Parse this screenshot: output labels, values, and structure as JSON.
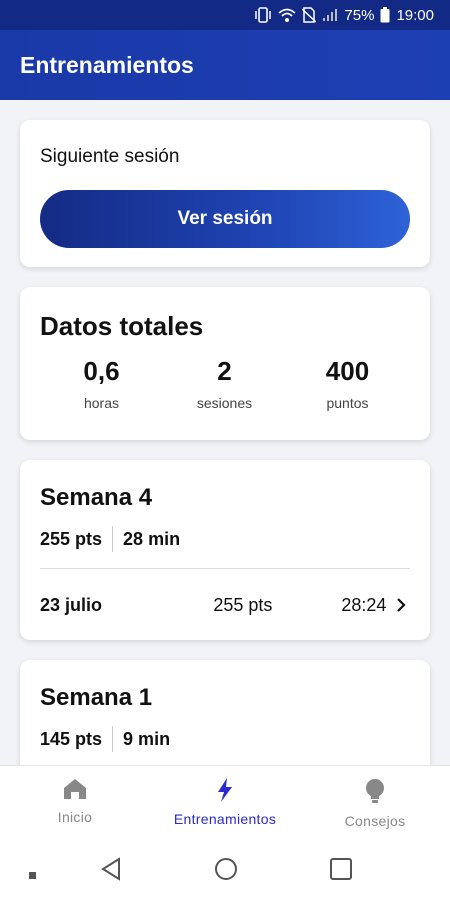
{
  "status_bar": {
    "battery": "75%",
    "time": "19:00"
  },
  "app_bar": {
    "title": "Entrenamientos"
  },
  "next_session": {
    "label": "Siguiente sesión",
    "button": "Ver sesión"
  },
  "totals": {
    "title": "Datos totales",
    "stats": [
      {
        "value": "0,6",
        "unit": "horas"
      },
      {
        "value": "2",
        "unit": "sesiones"
      },
      {
        "value": "400",
        "unit": "puntos"
      }
    ]
  },
  "weeks": [
    {
      "title": "Semana 4",
      "points": "255 pts",
      "minutes": "28 min",
      "sessions": [
        {
          "date": "23 julio",
          "points": "255 pts",
          "duration": "28:24"
        }
      ]
    },
    {
      "title": "Semana 1",
      "points": "145 pts",
      "minutes": "9 min"
    }
  ],
  "bottom_nav": {
    "items": [
      {
        "label": "Inicio",
        "icon": "home-icon"
      },
      {
        "label": "Entrenamientos",
        "icon": "bolt-icon",
        "active": true
      },
      {
        "label": "Consejos",
        "icon": "lightbulb-icon"
      }
    ]
  },
  "colors": {
    "primary": "#1d3fb4",
    "active_nav": "#2a2ad0",
    "background": "#f2f3f7"
  }
}
